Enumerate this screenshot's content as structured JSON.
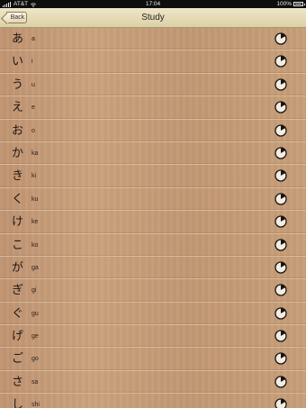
{
  "status_bar": {
    "carrier": "AT&T",
    "time": "17:04",
    "battery": "100%"
  },
  "nav": {
    "back_label": "Back",
    "title": "Study"
  },
  "items": [
    {
      "kana": "あ",
      "romaji": "a"
    },
    {
      "kana": "い",
      "romaji": "i"
    },
    {
      "kana": "う",
      "romaji": "u"
    },
    {
      "kana": "え",
      "romaji": "e"
    },
    {
      "kana": "お",
      "romaji": "o"
    },
    {
      "kana": "か",
      "romaji": "ka"
    },
    {
      "kana": "き",
      "romaji": "ki"
    },
    {
      "kana": "く",
      "romaji": "ku"
    },
    {
      "kana": "け",
      "romaji": "ke"
    },
    {
      "kana": "こ",
      "romaji": "ko"
    },
    {
      "kana": "が",
      "romaji": "ga"
    },
    {
      "kana": "ぎ",
      "romaji": "gi"
    },
    {
      "kana": "ぐ",
      "romaji": "gu"
    },
    {
      "kana": "げ",
      "romaji": "ge"
    },
    {
      "kana": "ご",
      "romaji": "go"
    },
    {
      "kana": "さ",
      "romaji": "sa"
    },
    {
      "kana": "し",
      "romaji": "shi"
    }
  ],
  "row_icon": "progress-pie-icon",
  "colors": {
    "nav_bar": "#e6dbb5",
    "paper": "#c49a74",
    "status_bar": "#0e0e0e"
  }
}
